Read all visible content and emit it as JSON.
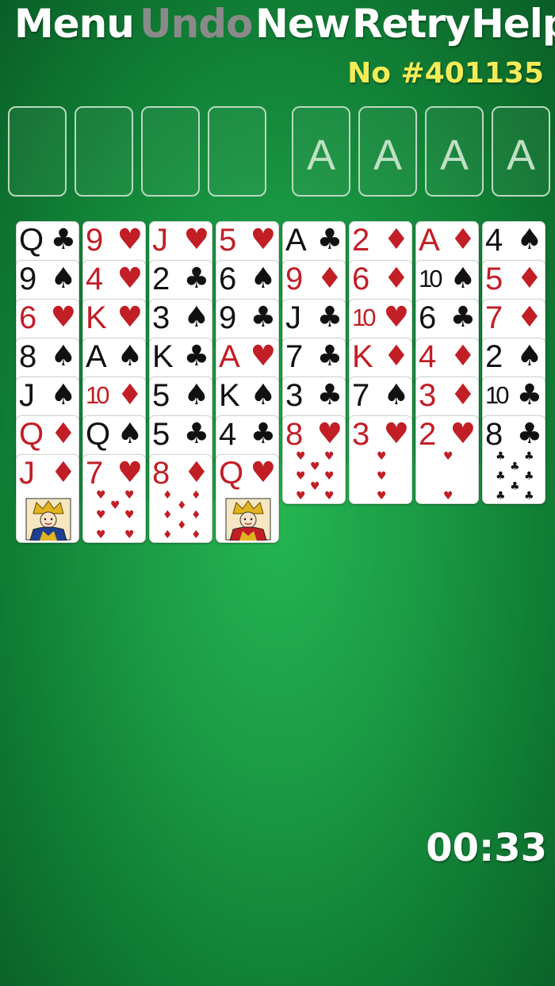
{
  "menu": {
    "items": [
      {
        "id": "menu",
        "label": "Menu",
        "enabled": true
      },
      {
        "id": "undo",
        "label": "Undo",
        "enabled": false
      },
      {
        "id": "new",
        "label": "New",
        "enabled": true
      },
      {
        "id": "retry",
        "label": "Retry",
        "enabled": true
      },
      {
        "id": "help",
        "label": "Help",
        "enabled": true
      }
    ]
  },
  "game_number": "No #401135",
  "free_cells": [
    {
      "label": ""
    },
    {
      "label": ""
    },
    {
      "label": ""
    },
    {
      "label": ""
    }
  ],
  "foundations": [
    {
      "label": "A"
    },
    {
      "label": "A"
    },
    {
      "label": "A"
    },
    {
      "label": "A"
    }
  ],
  "colors": {
    "red": "#c21e26",
    "black": "#111111",
    "felt": "#1a9a44",
    "title_yellow": "#f4ec57",
    "disabled": "#8a8a8a"
  },
  "tableau": [
    [
      {
        "rank": "Q",
        "suit": "♣",
        "color": "black"
      },
      {
        "rank": "9",
        "suit": "♠",
        "color": "black"
      },
      {
        "rank": "6",
        "suit": "♥",
        "color": "red"
      },
      {
        "rank": "8",
        "suit": "♠",
        "color": "black"
      },
      {
        "rank": "J",
        "suit": "♠",
        "color": "black"
      },
      {
        "rank": "Q",
        "suit": "♦",
        "color": "red"
      },
      {
        "rank": "J",
        "suit": "♦",
        "color": "red"
      }
    ],
    [
      {
        "rank": "9",
        "suit": "♥",
        "color": "red"
      },
      {
        "rank": "4",
        "suit": "♥",
        "color": "red"
      },
      {
        "rank": "K",
        "suit": "♥",
        "color": "red"
      },
      {
        "rank": "A",
        "suit": "♠",
        "color": "black"
      },
      {
        "rank": "10",
        "suit": "♦",
        "color": "red"
      },
      {
        "rank": "Q",
        "suit": "♠",
        "color": "black"
      },
      {
        "rank": "7",
        "suit": "♥",
        "color": "red"
      }
    ],
    [
      {
        "rank": "J",
        "suit": "♥",
        "color": "red"
      },
      {
        "rank": "2",
        "suit": "♣",
        "color": "black"
      },
      {
        "rank": "3",
        "suit": "♠",
        "color": "black"
      },
      {
        "rank": "K",
        "suit": "♣",
        "color": "black"
      },
      {
        "rank": "5",
        "suit": "♠",
        "color": "black"
      },
      {
        "rank": "5",
        "suit": "♣",
        "color": "black"
      },
      {
        "rank": "8",
        "suit": "♦",
        "color": "red"
      }
    ],
    [
      {
        "rank": "5",
        "suit": "♥",
        "color": "red"
      },
      {
        "rank": "6",
        "suit": "♠",
        "color": "black"
      },
      {
        "rank": "9",
        "suit": "♣",
        "color": "black"
      },
      {
        "rank": "A",
        "suit": "♥",
        "color": "red"
      },
      {
        "rank": "K",
        "suit": "♠",
        "color": "black"
      },
      {
        "rank": "4",
        "suit": "♣",
        "color": "black"
      },
      {
        "rank": "Q",
        "suit": "♥",
        "color": "red"
      }
    ],
    [
      {
        "rank": "A",
        "suit": "♣",
        "color": "black"
      },
      {
        "rank": "9",
        "suit": "♦",
        "color": "red"
      },
      {
        "rank": "J",
        "suit": "♣",
        "color": "black"
      },
      {
        "rank": "7",
        "suit": "♣",
        "color": "black"
      },
      {
        "rank": "3",
        "suit": "♣",
        "color": "black"
      },
      {
        "rank": "8",
        "suit": "♥",
        "color": "red"
      }
    ],
    [
      {
        "rank": "2",
        "suit": "♦",
        "color": "red"
      },
      {
        "rank": "6",
        "suit": "♦",
        "color": "red"
      },
      {
        "rank": "10",
        "suit": "♥",
        "color": "red"
      },
      {
        "rank": "K",
        "suit": "♦",
        "color": "red"
      },
      {
        "rank": "7",
        "suit": "♠",
        "color": "black"
      },
      {
        "rank": "3",
        "suit": "♥",
        "color": "red"
      }
    ],
    [
      {
        "rank": "A",
        "suit": "♦",
        "color": "red"
      },
      {
        "rank": "10",
        "suit": "♠",
        "color": "black"
      },
      {
        "rank": "6",
        "suit": "♣",
        "color": "black"
      },
      {
        "rank": "4",
        "suit": "♦",
        "color": "red"
      },
      {
        "rank": "3",
        "suit": "♦",
        "color": "red"
      },
      {
        "rank": "2",
        "suit": "♥",
        "color": "red"
      }
    ],
    [
      {
        "rank": "4",
        "suit": "♠",
        "color": "black"
      },
      {
        "rank": "5",
        "suit": "♦",
        "color": "red"
      },
      {
        "rank": "7",
        "suit": "♦",
        "color": "red"
      },
      {
        "rank": "2",
        "suit": "♠",
        "color": "black"
      },
      {
        "rank": "10",
        "suit": "♣",
        "color": "black"
      },
      {
        "rank": "8",
        "suit": "♣",
        "color": "black"
      }
    ]
  ],
  "timer": "00:33"
}
